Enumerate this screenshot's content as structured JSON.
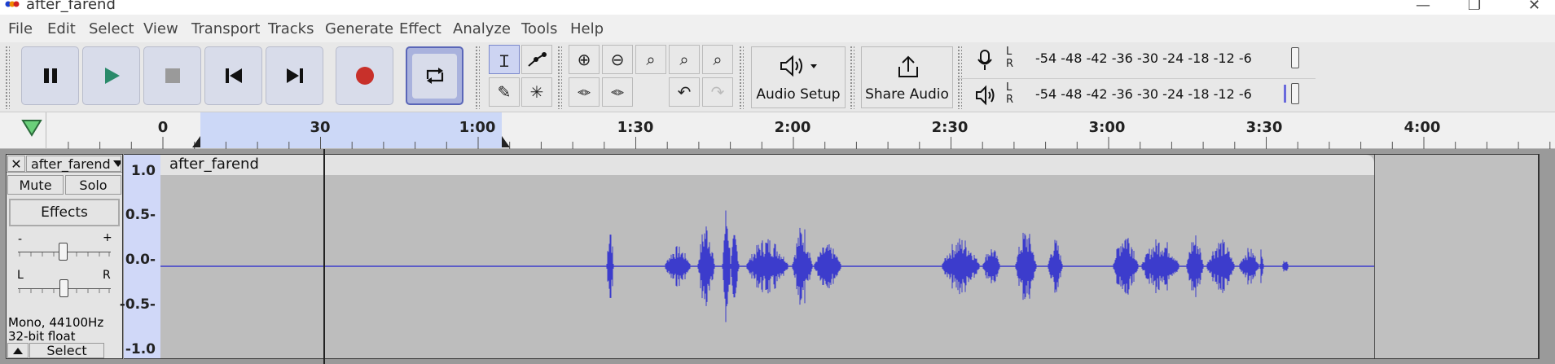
{
  "window": {
    "title": "after_farend"
  },
  "menu": [
    "File",
    "Edit",
    "Select",
    "View",
    "Transport",
    "Tracks",
    "Generate",
    "Effect",
    "Analyze",
    "Tools",
    "Help"
  ],
  "toolbar": {
    "audio_setup_label": "Audio Setup",
    "share_audio_label": "Share Audio",
    "record_meter": {
      "l": "L",
      "r": "R",
      "scale": [
        "-54",
        "-48",
        "-42",
        "-36",
        "-30",
        "-24",
        "-18",
        "-12",
        "-6"
      ]
    },
    "play_meter": {
      "l": "L",
      "r": "R",
      "scale": [
        "-54",
        "-48",
        "-42",
        "-36",
        "-30",
        "-24",
        "-18",
        "-12",
        "-6"
      ]
    },
    "accent": "#3a3fc4",
    "record_color": "#c8302a",
    "play_color": "#2a8a6a"
  },
  "ruler": {
    "labels": [
      "0",
      "30",
      "1:00",
      "1:30",
      "2:00",
      "2:30",
      "3:00",
      "3:30",
      "4:00"
    ],
    "selection_color": "#ccd8f7"
  },
  "track": {
    "name": "after_farend",
    "mute_label": "Mute",
    "solo_label": "Solo",
    "effects_label": "Effects",
    "gain_minus": "-",
    "gain_plus": "+",
    "pan_left": "L",
    "pan_right": "R",
    "format_line1": "Mono, 44100Hz",
    "format_line2": "32-bit float",
    "select_label": "Select",
    "scale": [
      "1.0",
      "0.5-",
      "0.0-",
      "-0.5-",
      "-1.0"
    ],
    "clip_name": "after_farend",
    "wave_color": "#3c3ccc"
  }
}
